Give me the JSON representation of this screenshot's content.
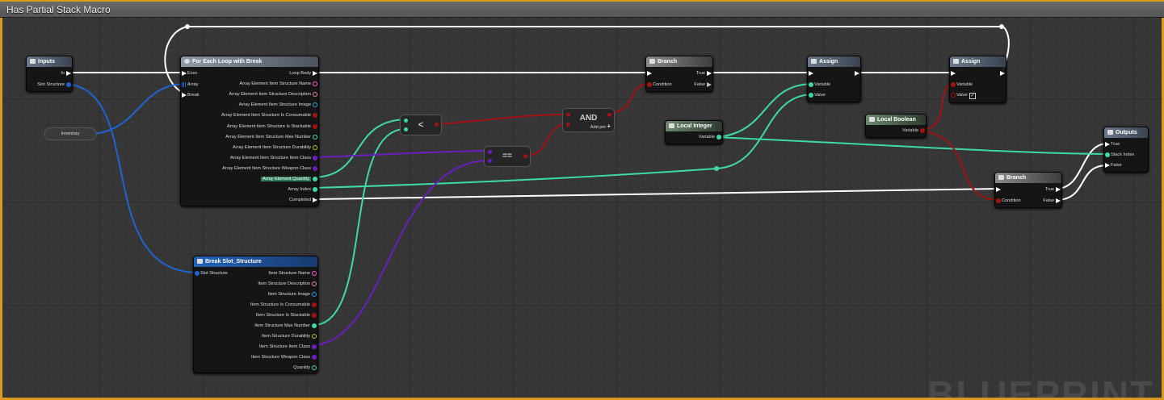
{
  "window": {
    "title": "Has Partial Stack Macro"
  },
  "watermark": "BLUEPRINT",
  "colors": {
    "exec": "#ffffff",
    "struct": "#1f63d1",
    "integer": "#3fd9a8",
    "boolean": "#a31212",
    "class": "#6b1ec0",
    "string": "#ff5ad3",
    "text": "#e87fa8",
    "texture": "#1aa5e0"
  },
  "nodes": {
    "inputs": {
      "title": "Inputs",
      "pins": {
        "in": "In",
        "slot": "Slot Structure"
      }
    },
    "inventory": {
      "label": "Inventory"
    },
    "foreach": {
      "title": "For Each Loop with Break",
      "left": {
        "exec": "Exec",
        "array": "Array",
        "break": "Break"
      },
      "right": [
        "Loop Body",
        "Array Element Item Structure Name",
        "Array Element Item Structure Description",
        "Array Element Item Structure Image",
        "Array Element Item Structure Is Consumable",
        "Array Element Item Structure Is Stackable",
        "Array Element Item Structure Max Number",
        "Array Element Item Structure Durability",
        "Array Element Item Structure Item Class",
        "Array Element Item Structure Weapon Class",
        "Array Element Quantity",
        "Array Index",
        "Completed"
      ]
    },
    "breakslot": {
      "title": "Break Slot_Structure",
      "left": "Slot Structure",
      "right": [
        "Item Structure Name",
        "Item Structure Description",
        "Item Structure Image",
        "Item Structure Is Consumable",
        "Item Structure Is Stackable",
        "Item Structure Max Number",
        "Item Structure Durability",
        "Item Structure Item Class",
        "Item Structure Weapon Class",
        "Quantity"
      ]
    },
    "less": {
      "label": "<"
    },
    "equal": {
      "label": "=="
    },
    "and": {
      "label": "AND",
      "addpin": "Add pin"
    },
    "branch1": {
      "title": "Branch",
      "condition": "Condition",
      "true": "True",
      "false": "False"
    },
    "localint": {
      "title": "Local Integer",
      "variable": "Variable"
    },
    "assign1": {
      "title": "Assign",
      "variable": "Variable",
      "value": "Value"
    },
    "localbool": {
      "title": "Local Boolean",
      "variable": "Variable"
    },
    "assign2": {
      "title": "Assign",
      "variable": "Variable",
      "value": "Value",
      "checked": true
    },
    "branch2": {
      "title": "Branch",
      "condition": "Condition",
      "true": "True",
      "false": "False"
    },
    "outputs": {
      "title": "Outputs",
      "pins": {
        "true": "True",
        "stack": "Stack Index",
        "false": "False"
      }
    }
  }
}
